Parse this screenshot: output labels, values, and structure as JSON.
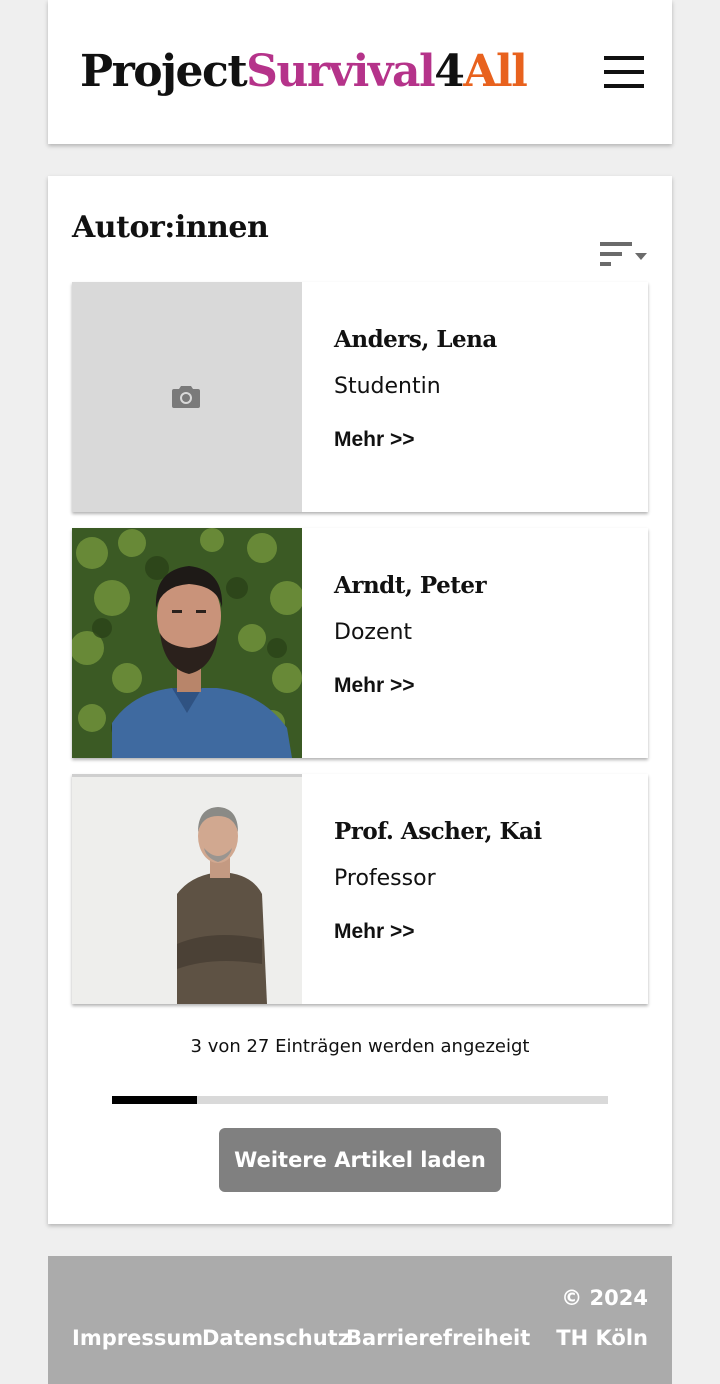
{
  "header": {
    "logo": {
      "part1": "Project",
      "part2": "Survival",
      "part3": "4",
      "part4": "All"
    },
    "menu_icon": "hamburger-menu-icon"
  },
  "colors": {
    "brand_magenta": "#b5338a",
    "brand_orange": "#e8621e",
    "button_gray": "#808080",
    "footer_gray": "#ababab"
  },
  "main": {
    "title": "Autor:innen",
    "sort_icon": "sort-icon",
    "authors": [
      {
        "name": "Anders, Lena",
        "role": "Studentin",
        "more": "Mehr >>",
        "image": "camera-placeholder-icon"
      },
      {
        "name": "Arndt, Peter",
        "role": "Dozent",
        "more": "Mehr >>",
        "image": "photo-man-beard-denim-shirt"
      },
      {
        "name": "Prof. Ascher, Kai",
        "role": "Professor",
        "more": "Mehr >>",
        "image": "photo-man-gray-hair-arms-crossed"
      }
    ],
    "count_text": "3 von 27 Einträgen werden angezeigt",
    "progress": {
      "shown": 3,
      "total": 27
    },
    "load_more": "Weitere Artikel laden"
  },
  "footer": {
    "links": [
      "Impressum",
      "Datenschutz",
      "Barrierefreiheit"
    ],
    "copyright": "© 2024",
    "org": "TH Köln"
  }
}
